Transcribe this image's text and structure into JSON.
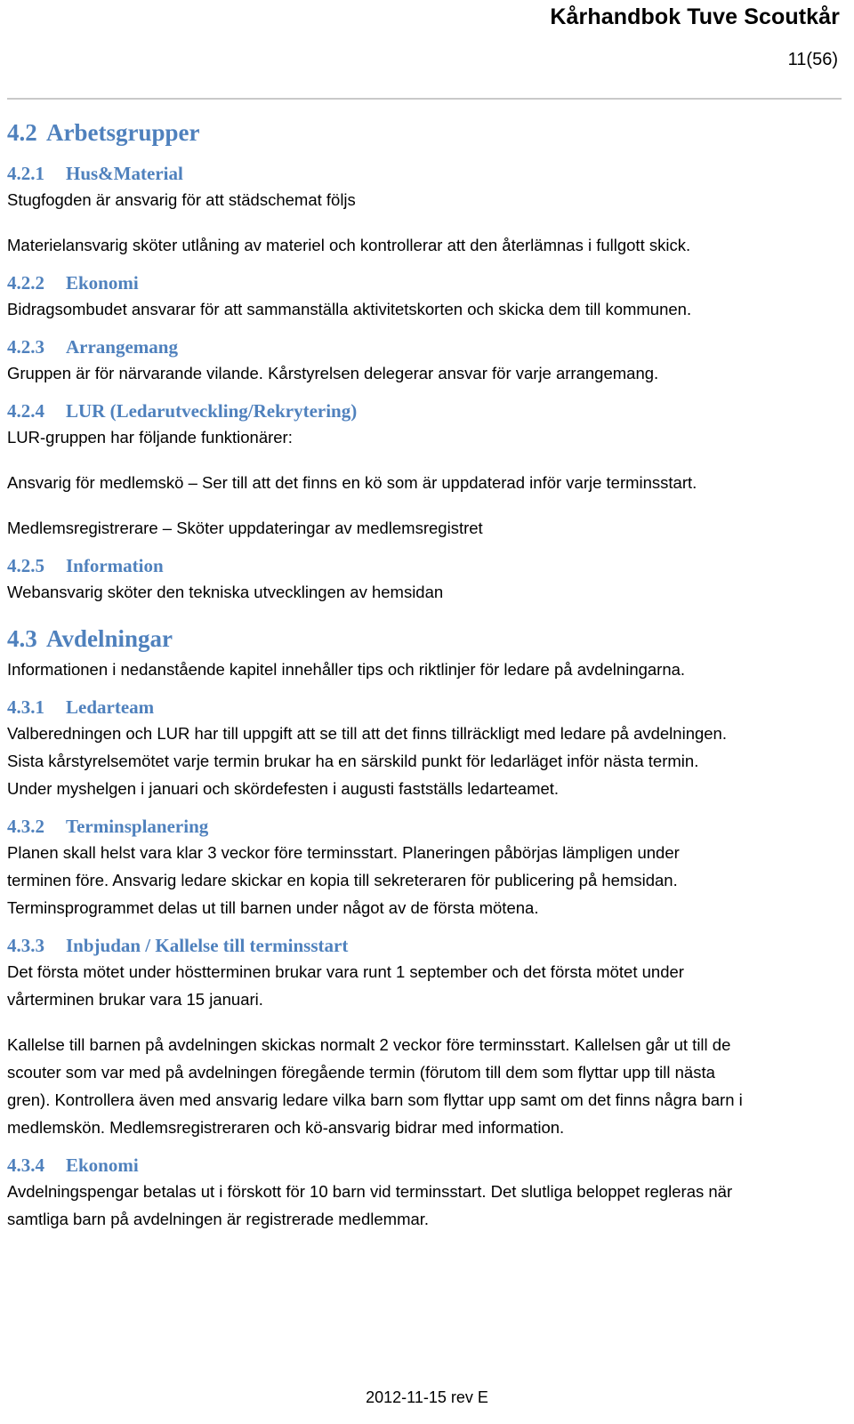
{
  "header": {
    "title": "Kårhandbok Tuve Scoutkår",
    "page_number": "11(56)"
  },
  "footer": {
    "revision": "2012-11-15 rev E"
  },
  "colors": {
    "heading": "#4F81BD",
    "body_text": "#000000",
    "rule": "#C9C9C9",
    "background": "#FFFFFF"
  },
  "sections": {
    "s42": {
      "number": "4.2",
      "title": "Arbetsgrupper"
    },
    "s421": {
      "number": "4.2.1",
      "title": "Hus&Material",
      "p1": "Stugfogden är ansvarig för att städschemat följs",
      "p2": "Materielansvarig sköter utlåning av materiel och kontrollerar att den återlämnas i fullgott skick."
    },
    "s422": {
      "number": "4.2.2",
      "title": "Ekonomi",
      "p1": "Bidragsombudet ansvarar för att sammanställa aktivitetskorten och skicka dem till kommunen."
    },
    "s423": {
      "number": "4.2.3",
      "title": "Arrangemang",
      "p1": "Gruppen är för närvarande vilande. Kårstyrelsen delegerar ansvar för varje arrangemang."
    },
    "s424": {
      "number": "4.2.4",
      "title": "LUR (Ledarutveckling/Rekrytering)",
      "p1": "LUR-gruppen har följande funktionärer:",
      "p2": "Ansvarig för medlemskö – Ser till att det finns en kö som är uppdaterad inför varje terminsstart.",
      "p3": "Medlemsregistrerare – Sköter uppdateringar av medlemsregistret"
    },
    "s425": {
      "number": "4.2.5",
      "title": "Information",
      "p1": "Webansvarig sköter den tekniska utvecklingen av hemsidan"
    },
    "s43": {
      "number": "4.3",
      "title": "Avdelningar",
      "p1": "Informationen i nedanstående kapitel innehåller tips och riktlinjer för ledare på avdelningarna."
    },
    "s431": {
      "number": "4.3.1",
      "title": "Ledarteam",
      "p1": "Valberedningen och LUR har till uppgift att se till att det finns tillräckligt med ledare på avdelningen.",
      "p2": "Sista kårstyrelsemötet varje termin brukar ha en särskild punkt för ledarläget inför nästa termin.",
      "p3": "Under myshelgen i januari och skördefesten i augusti fastställs ledarteamet."
    },
    "s432": {
      "number": "4.3.2",
      "title": "Terminsplanering",
      "p1": "Planen skall helst vara klar 3 veckor före terminsstart. Planeringen påbörjas lämpligen under",
      "p2": "terminen före. Ansvarig ledare skickar en kopia till sekreteraren för publicering på hemsidan.",
      "p3": "Terminsprogrammet delas ut till barnen under något av de första mötena."
    },
    "s433": {
      "number": "4.3.3",
      "title": "Inbjudan / Kallelse till terminsstart",
      "p1": "Det första mötet under höstterminen brukar vara runt 1 september och det första mötet under",
      "p2": "vårterminen brukar vara 15 januari.",
      "p3": "Kallelse till barnen på avdelningen skickas normalt 2 veckor före terminsstart. Kallelsen går ut till de",
      "p4": "scouter som var med på avdelningen föregående termin (förutom till dem som flyttar upp till nästa",
      "p5": "gren). Kontrollera även med ansvarig ledare vilka barn som flyttar upp samt om det finns några barn i",
      "p6": "medlemskön. Medlemsregistreraren och kö-ansvarig bidrar med information."
    },
    "s434": {
      "number": "4.3.4",
      "title": "Ekonomi",
      "p1": "Avdelningspengar betalas ut i förskott för 10 barn vid terminsstart. Det slutliga beloppet regleras när",
      "p2": "samtliga barn på avdelningen är registrerade medlemmar."
    }
  }
}
